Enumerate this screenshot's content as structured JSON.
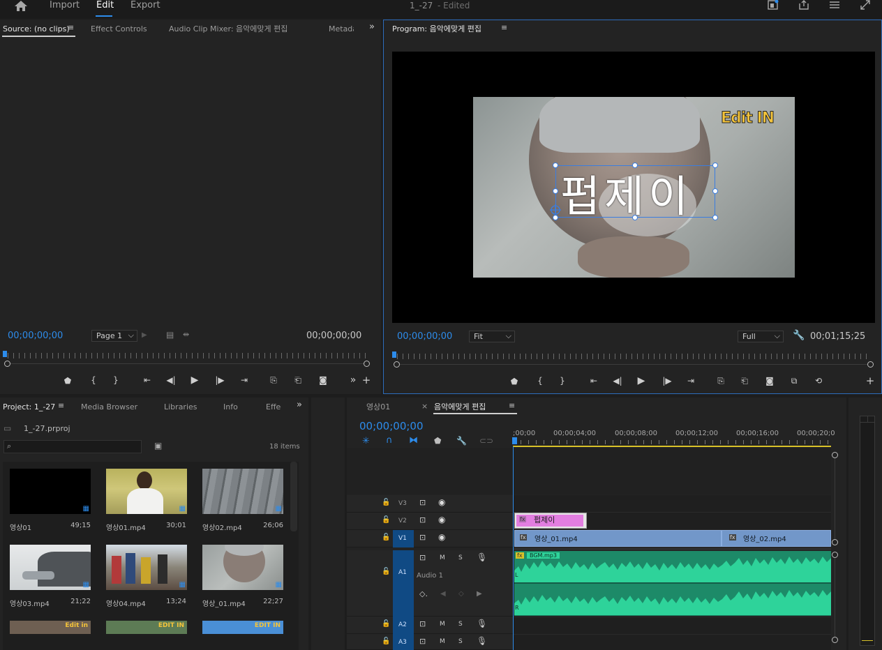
{
  "nav": {
    "import": "Import",
    "edit": "Edit",
    "export": "Export",
    "project_name": "1_-27",
    "edited": "- Edited"
  },
  "source_panel": {
    "tabs": [
      "Source: (no clips)",
      "Effect Controls",
      "Audio Clip Mixer: 음악에맞게 편집",
      "Metadata"
    ],
    "timecode_left": "00;00;00;00",
    "page_select": "Page 1",
    "timecode_right": "00;00;00;00"
  },
  "program_panel": {
    "title": "Program: 음악에맞게 편집",
    "timecode_left": "00;00;00;00",
    "fit": "Fit",
    "quality": "Full",
    "timecode_right": "00;01;15;25",
    "video": {
      "logo_text": "Edit IN",
      "title_text": "펍제이"
    }
  },
  "project_panel": {
    "tabs": [
      "Project: 1_-27",
      "Media Browser",
      "Libraries",
      "Info",
      "Effects"
    ],
    "project_file": "1_-27.prproj",
    "search_placeholder": "",
    "item_count": "18 items",
    "items": [
      {
        "name": "영상01",
        "duration": "49;15"
      },
      {
        "name": "영상01.mp4",
        "duration": "30;01"
      },
      {
        "name": "영상02.mp4",
        "duration": "26;06"
      },
      {
        "name": "영상03.mp4",
        "duration": "21;22"
      },
      {
        "name": "영상04.mp4",
        "duration": "13;24"
      },
      {
        "name": "영상_01.mp4",
        "duration": "22;27"
      }
    ],
    "partial_labels": [
      "Edit in",
      "EDIT IN",
      "EDIT IN"
    ]
  },
  "timeline": {
    "tabs": [
      "영상01",
      "음악에맞게 편집"
    ],
    "close_glyph": "×",
    "timecode": "00;00;00;00",
    "ruler_labels": [
      ";00;00",
      "00;00;04;00",
      "00;00;08;00",
      "00;00;12;00",
      "00;00;16;00",
      "00;00;20;0"
    ],
    "tracks": [
      {
        "id": "V3"
      },
      {
        "id": "V2"
      },
      {
        "id": "V1"
      },
      {
        "id": "A1",
        "name": "Audio 1"
      },
      {
        "id": "A2"
      },
      {
        "id": "A3"
      }
    ],
    "clips": {
      "title_clip": "펍제이",
      "v1_a": "영상_01.mp4",
      "v1_b": "영상_02.mp4",
      "audio": "BGM.mp3",
      "fx": "fx",
      "ch_l": "L",
      "ch_r": "R"
    },
    "track_buttons": {
      "m": "M",
      "s": "S"
    }
  },
  "colors": {
    "accent": "#2d8ceb",
    "title_clip": "#e27ee0",
    "video_clip": "#7297c9",
    "audio_clip": "#1e8c6a",
    "wave": "#2ed39a",
    "track_target": "#104a84"
  }
}
